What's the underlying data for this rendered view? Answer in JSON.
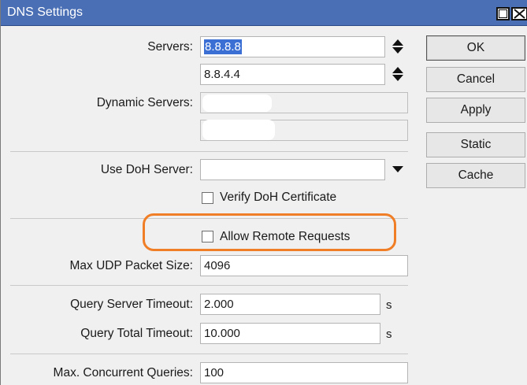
{
  "window": {
    "title": "DNS Settings"
  },
  "form": {
    "servers_label": "Servers:",
    "servers": [
      "8.8.8.8",
      "8.8.4.4"
    ],
    "dynamic_servers_label": "Dynamic Servers:",
    "use_doh_label": "Use DoH Server:",
    "use_doh_value": "",
    "verify_doh_label": "Verify DoH Certificate",
    "verify_doh_checked": false,
    "allow_remote_label": "Allow Remote Requests",
    "allow_remote_checked": false,
    "max_udp_label": "Max UDP Packet Size:",
    "max_udp_value": "4096",
    "query_server_timeout_label": "Query Server Timeout:",
    "query_server_timeout_value": "2.000",
    "query_server_timeout_unit": "s",
    "query_total_timeout_label": "Query Total Timeout:",
    "query_total_timeout_value": "10.000",
    "query_total_timeout_unit": "s",
    "max_concurrent_label": "Max. Concurrent Queries:",
    "max_concurrent_value": "100"
  },
  "buttons": {
    "ok": "OK",
    "cancel": "Cancel",
    "apply": "Apply",
    "static": "Static",
    "cache": "Cache"
  },
  "colors": {
    "titlebar": "#4a6fb5",
    "selection": "#3b6fd4",
    "highlight": "#f07e26"
  },
  "icons": {
    "restore": "window-restore-icon",
    "close": "window-close-icon",
    "updown": "updown-arrows-icon",
    "dropdown": "dropdown-arrow-icon"
  }
}
